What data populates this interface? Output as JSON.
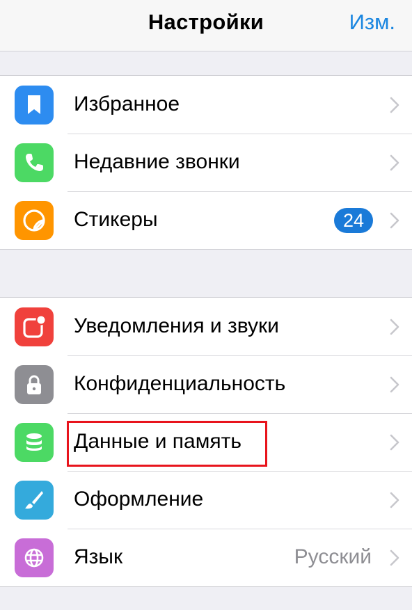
{
  "header": {
    "title": "Настройки",
    "edit_label": "Изм."
  },
  "groups": [
    {
      "items": [
        {
          "label": "Избранное",
          "icon": "bookmark-icon",
          "color": "#2d8cf0"
        },
        {
          "label": "Недавние звонки",
          "icon": "phone-icon",
          "color": "#4cd964"
        },
        {
          "label": "Стикеры",
          "icon": "sticker-icon",
          "color": "#ff9500",
          "badge": "24"
        }
      ]
    },
    {
      "items": [
        {
          "label": "Уведомления и звуки",
          "icon": "notification-icon",
          "color": "#f0413c"
        },
        {
          "label": "Конфиденциальность",
          "icon": "lock-icon",
          "color": "#8e8e93"
        },
        {
          "label": "Данные и память",
          "icon": "database-icon",
          "color": "#4cd964"
        },
        {
          "label": "Оформление",
          "icon": "brush-icon",
          "color": "#34aadc"
        },
        {
          "label": "Язык",
          "icon": "globe-icon",
          "color": "#c86dd7",
          "value": "Русский"
        }
      ]
    }
  ],
  "colors": {
    "accent": "#1a86e0",
    "badge": "#1a7ad8",
    "highlight_box": "#e8141c"
  }
}
